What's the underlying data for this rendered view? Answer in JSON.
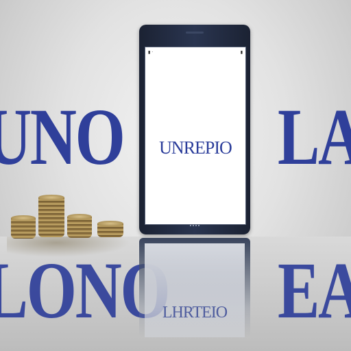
{
  "scene": {
    "left_word": "UNO",
    "right_word": "LA",
    "left_reflection_word": "LONO",
    "right_reflection_word": "EA",
    "accent_color": "#2f3f9a"
  },
  "phone": {
    "screen_text": "UNREPIO",
    "reflection_text": "LHRTEIO"
  }
}
